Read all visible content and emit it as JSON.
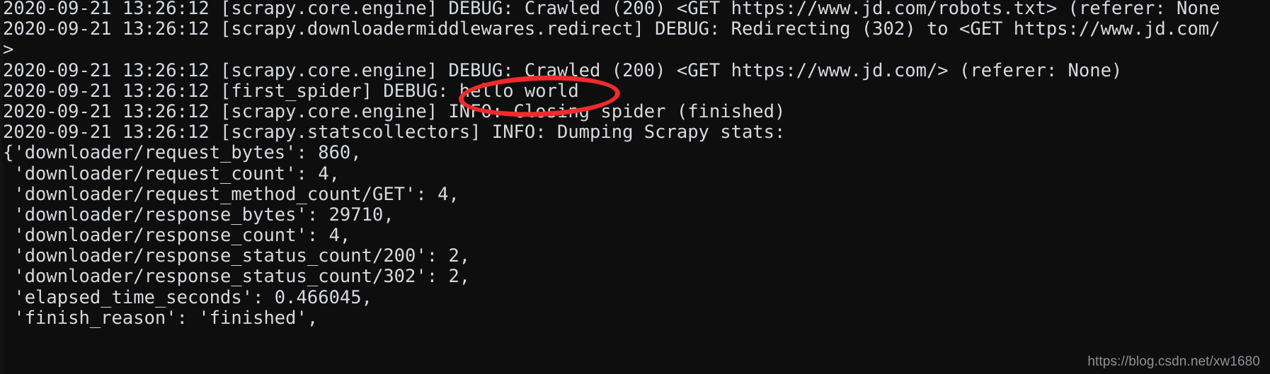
{
  "terminal": {
    "background_color": "#0e0e0e",
    "text_color": "#d6d9de",
    "accent_color": "#ef2b2b",
    "lines": [
      "2020-09-21 13:26:12 [scrapy.core.engine] DEBUG: Crawled (200) <GET https://www.jd.com/robots.txt> (referer: None",
      "2020-09-21 13:26:12 [scrapy.downloadermiddlewares.redirect] DEBUG: Redirecting (302) to <GET https://www.jd.com/",
      ">",
      "2020-09-21 13:26:12 [scrapy.core.engine] DEBUG: Crawled (200) <GET https://www.jd.com/> (referer: None)",
      "2020-09-21 13:26:12 [first_spider] DEBUG: hello world",
      "2020-09-21 13:26:12 [scrapy.core.engine] INFO: Closing spider (finished)",
      "2020-09-21 13:26:12 [scrapy.statscollectors] INFO: Dumping Scrapy stats:",
      "{'downloader/request_bytes': 860,",
      " 'downloader/request_count': 4,",
      " 'downloader/request_method_count/GET': 4,",
      " 'downloader/response_bytes': 29710,",
      " 'downloader/response_count': 4,",
      " 'downloader/response_status_count/200': 2,",
      " 'downloader/response_status_count/302': 2,",
      " 'elapsed_time_seconds': 0.466045,",
      " 'finish_reason': 'finished',"
    ]
  },
  "annotation": {
    "type": "ellipse",
    "color": "#ef2b2b",
    "target_text": "hello world"
  },
  "watermark": {
    "text": "https://blog.csdn.net/xw1680"
  }
}
